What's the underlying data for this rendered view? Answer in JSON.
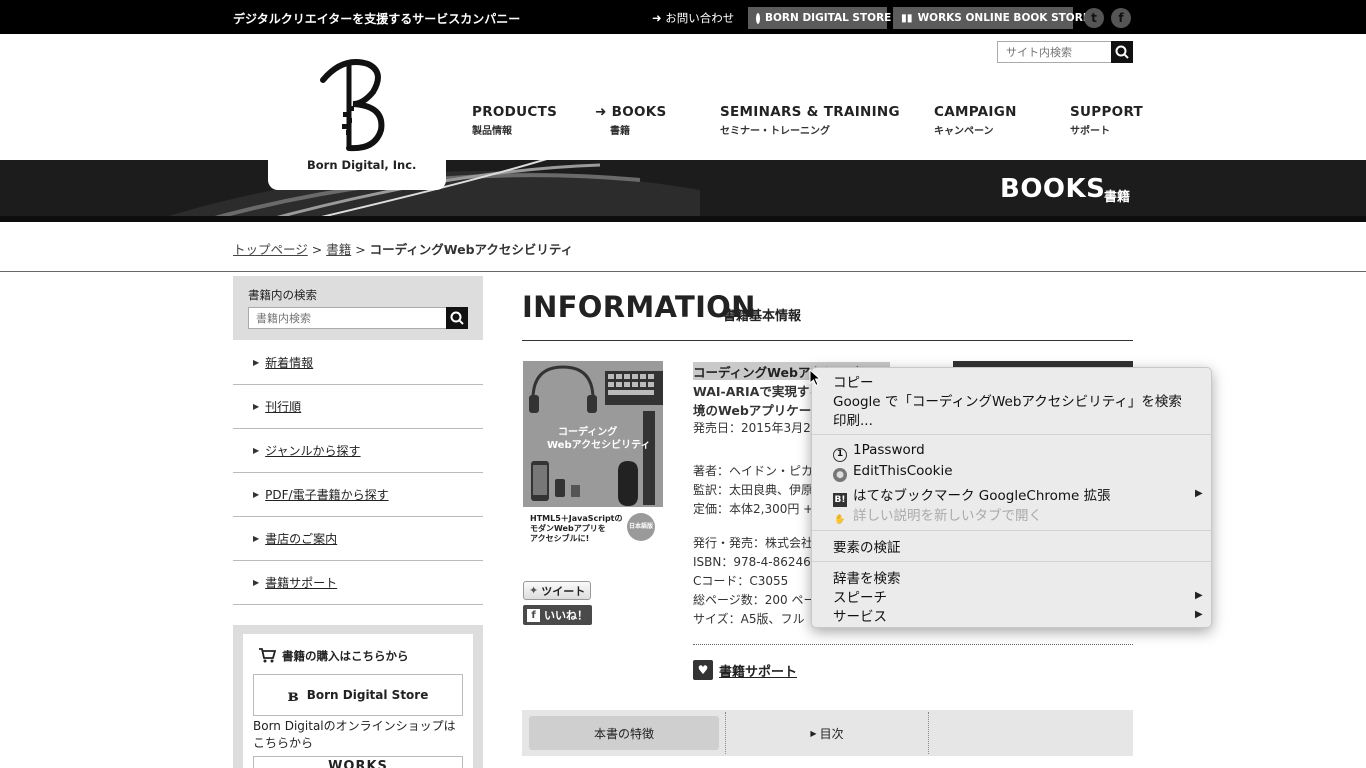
{
  "topbar": {
    "tagline": "デジタルクリエイターを支援するサービスカンパニー",
    "contact": "お問い合わせ",
    "store": "BORN DIGITAL STORE",
    "works": "WORKS ONLINE BOOK STORE",
    "social": [
      "twitter-icon",
      "facebook-icon"
    ]
  },
  "header": {
    "search_placeholder": "サイト内検索",
    "logo_text": "Born Digital, Inc.",
    "nav": [
      {
        "en": "PRODUCTS",
        "jp": "製品情報"
      },
      {
        "en": "BOOKS",
        "jp": "書籍"
      },
      {
        "en": "SEMINARS & TRAINING",
        "jp": "セミナー・トレーニング"
      },
      {
        "en": "CAMPAIGN",
        "jp": "キャンペーン"
      },
      {
        "en": "SUPPORT",
        "jp": "サポート"
      }
    ]
  },
  "banner": {
    "title": "BOOKS",
    "sub": "書籍"
  },
  "breadcrumb": {
    "home": "トップページ",
    "books": "書籍",
    "current": "コーディングWebアクセシビリティ"
  },
  "sidebar": {
    "search_label": "書籍内の検索",
    "search_placeholder": "書籍内検索",
    "items": [
      "新着情報",
      "刊行順",
      "ジャンルから探す",
      "PDF/電子書籍から探す",
      "書店のご案内",
      "書籍サポート"
    ],
    "buy_title": "書籍の購入はこちらから",
    "store_button": "Born Digital Store",
    "store_desc": "Born Digitalのオンラインショップはこちらから",
    "works_label": "WORKS"
  },
  "main": {
    "title": "INFORMATION",
    "subtitle": "書籍基本情報",
    "book_title": "コーディングWebアクセシビリティ",
    "book_sub1": "WAI-ARIAで実現する",
    "book_sub2": "境のWebアプリケーシ",
    "release": "発売日：2015年3月2",
    "author": "著者：ヘイドン・ピカ",
    "supervisor": "監訳：太田良典、伊原",
    "price": "定価：本体2,300円 +",
    "publisher": "発行・発売：株式会社",
    "isbn": "ISBN：978-4-86246",
    "ccode": "Cコード：C3055",
    "pages": "総ページ数：200 ペー",
    "size": "サイズ：A5版、フル",
    "tweet": "ツイート",
    "like": "いいね！",
    "support": "書籍サポート",
    "tabs": [
      "本書の特徴",
      "目次"
    ]
  },
  "cover": {
    "title1": "コーディング",
    "title2": "Webアクセシビリティ",
    "tag1": "HTML5＋JavaScriptの",
    "tag2": "モダンWebアプリを",
    "tag3": "アクセシブルに!",
    "badge": "日本語版"
  },
  "context_menu": {
    "copy": "コピー",
    "search_google": "Google で「コーディングWebアクセシビリティ」を検索",
    "print": "印刷...",
    "onepassword": "1Password",
    "editcookie": "EditThisCookie",
    "hatena": "はてなブックマーク GoogleChrome 拡張",
    "details": "詳しい説明を新しいタブで開く",
    "inspect": "要素の検証",
    "dictionary": "辞書を検索",
    "speech": "スピーチ",
    "services": "サービス"
  }
}
